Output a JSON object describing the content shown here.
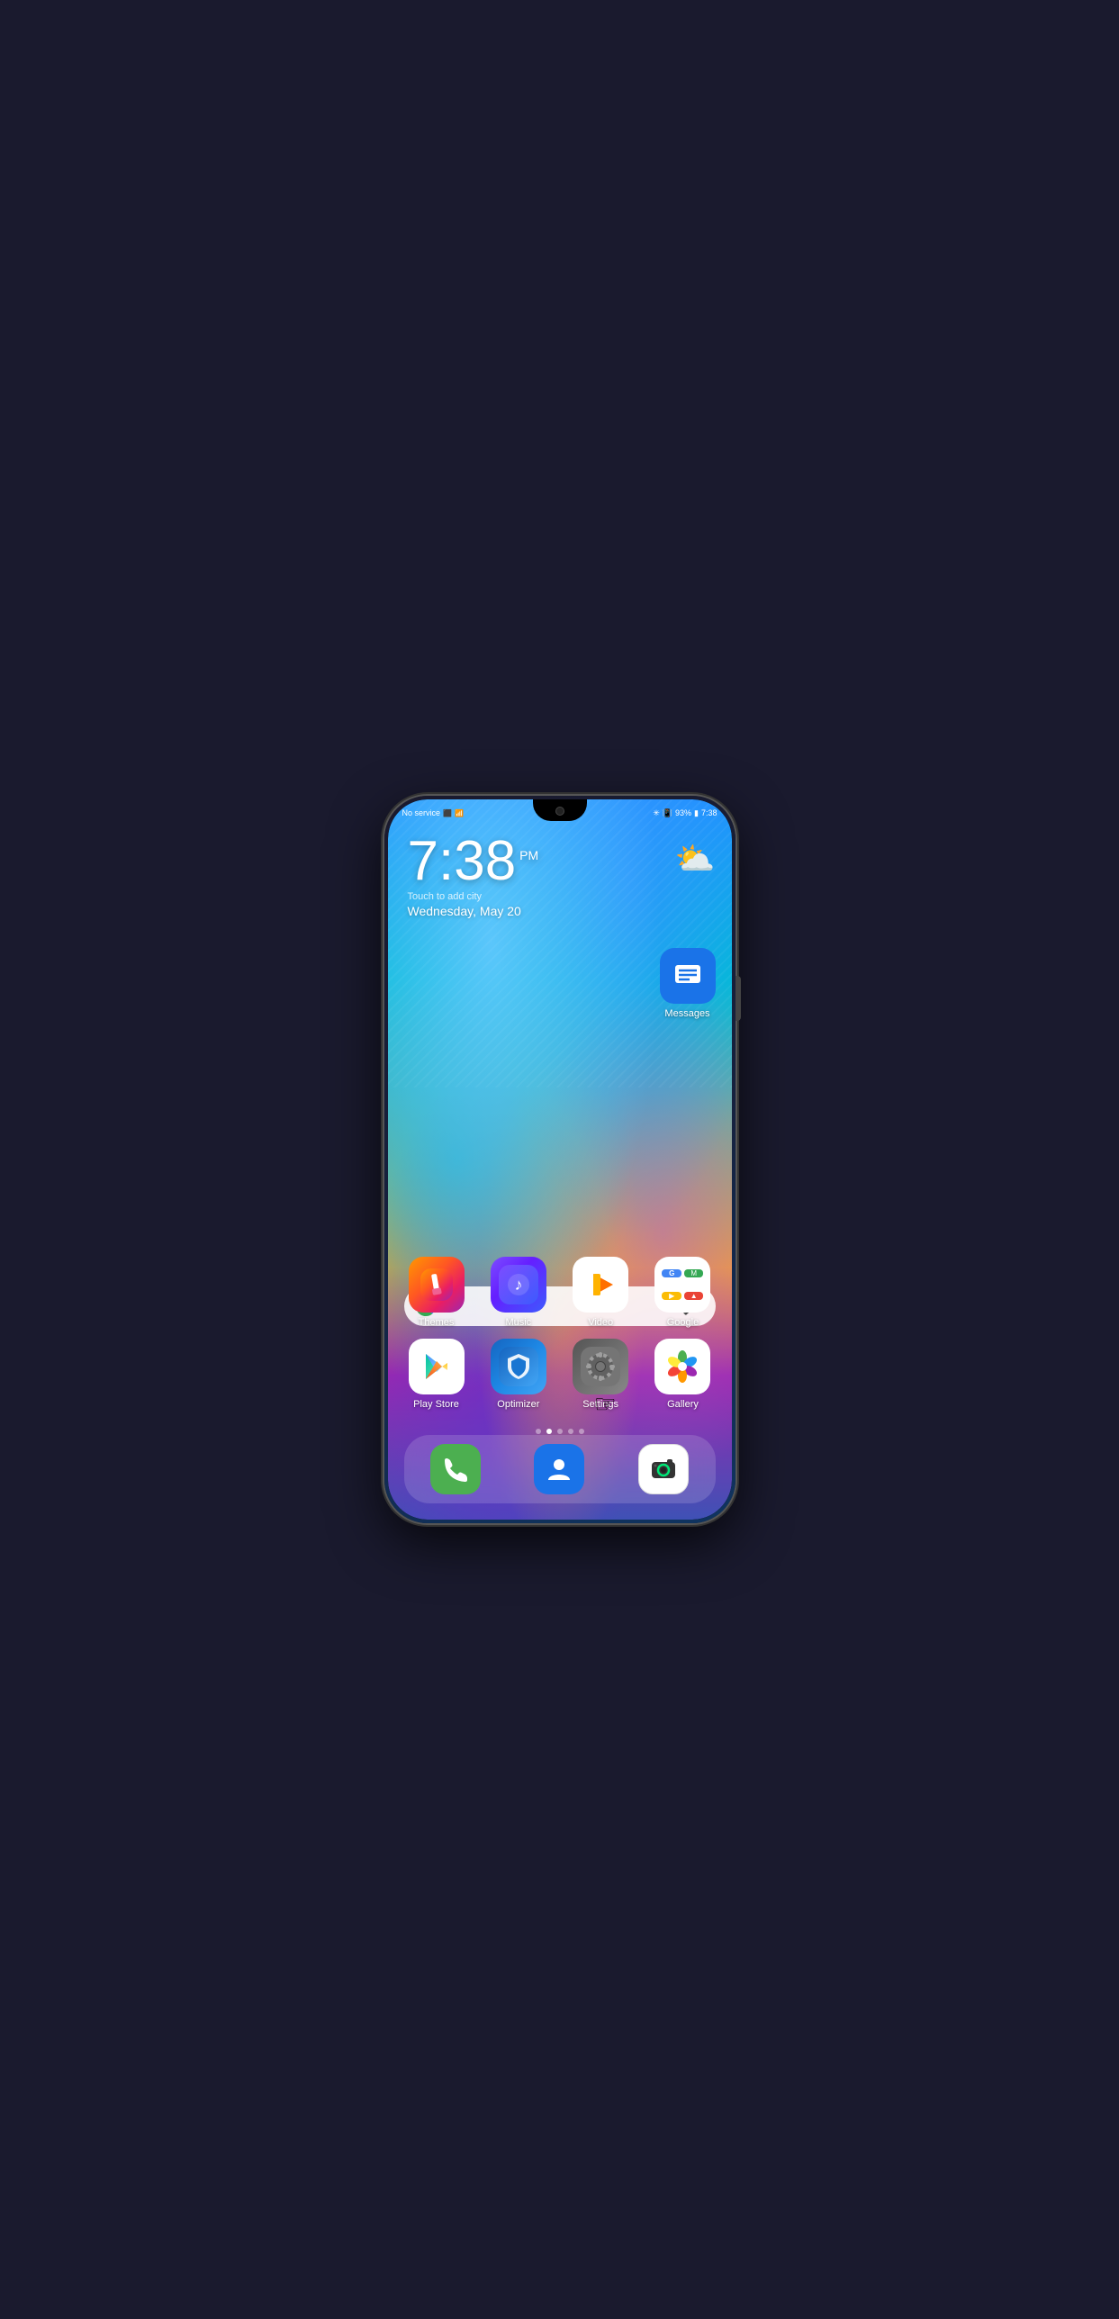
{
  "phone": {
    "status_bar": {
      "left": "No service",
      "signal_icons": "📶",
      "right_items": "93%",
      "battery": "🔋",
      "time": "7:38",
      "bluetooth": "⚡"
    },
    "clock": {
      "time": "7:38",
      "ampm": "PM",
      "subtitle": "Touch to add city",
      "date": "Wednesday, May 20"
    },
    "weather": {
      "icon": "⛅"
    },
    "messages": {
      "label": "Messages"
    },
    "search": {
      "placeholder": ""
    },
    "apps_row1": [
      {
        "label": "Themes",
        "icon_type": "themes"
      },
      {
        "label": "Music",
        "icon_type": "music"
      },
      {
        "label": "Video",
        "icon_type": "video"
      },
      {
        "label": "Google",
        "icon_type": "google_folder"
      }
    ],
    "apps_row2": [
      {
        "label": "Play Store",
        "icon_type": "playstore"
      },
      {
        "label": "Optimizer",
        "icon_type": "optimizer"
      },
      {
        "label": "Settings",
        "icon_type": "settings"
      },
      {
        "label": "Gallery",
        "icon_type": "gallery"
      }
    ],
    "dock": [
      {
        "label": "Phone",
        "icon_type": "phone"
      },
      {
        "label": "Contacts",
        "icon_type": "contacts"
      },
      {
        "label": "Camera",
        "icon_type": "camera"
      }
    ],
    "page_dots": [
      {
        "active": false
      },
      {
        "active": true
      },
      {
        "active": false
      },
      {
        "active": false
      },
      {
        "active": false
      }
    ]
  }
}
